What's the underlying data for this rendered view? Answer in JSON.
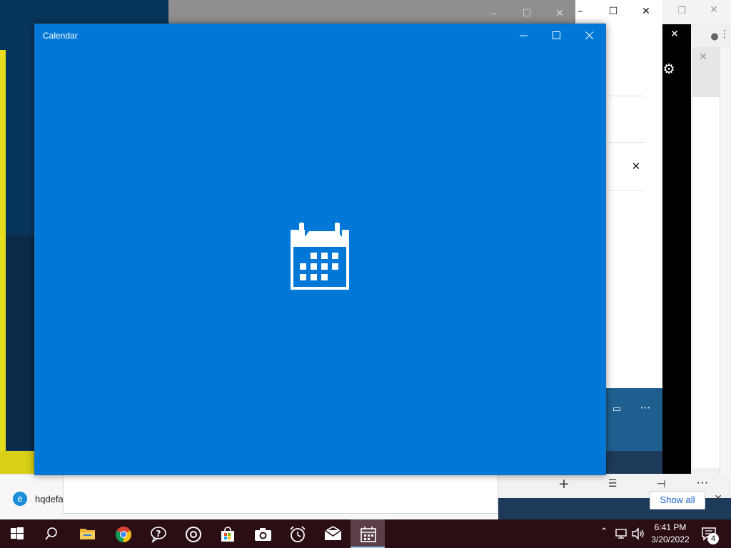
{
  "calendar_window": {
    "title": "Calendar",
    "minimize_label": "–",
    "maximize_label": "☐",
    "close_label": "✕"
  },
  "downloads_bar": {
    "item_name": "hqdefa",
    "show_all_label": "Show all"
  },
  "taskbar": {
    "items": [
      {
        "name": "start",
        "icon": "windows-logo-icon"
      },
      {
        "name": "search",
        "icon": "search-icon"
      },
      {
        "name": "file-explorer",
        "icon": "folder-icon"
      },
      {
        "name": "chrome",
        "icon": "chrome-icon"
      },
      {
        "name": "get-help",
        "icon": "help-chat-icon"
      },
      {
        "name": "groove-music",
        "icon": "music-disc-icon"
      },
      {
        "name": "store",
        "icon": "store-bag-icon"
      },
      {
        "name": "camera",
        "icon": "camera-icon"
      },
      {
        "name": "alarms",
        "icon": "alarm-clock-icon"
      },
      {
        "name": "mail",
        "icon": "mail-icon"
      },
      {
        "name": "calendar",
        "icon": "calendar-icon",
        "active": true
      }
    ],
    "clock": {
      "time": "6:41 PM",
      "date": "3/20/2022"
    },
    "notification_count": "4"
  },
  "colors": {
    "calendar_accent": "#0078d7",
    "taskbar": "#2b0e14"
  }
}
